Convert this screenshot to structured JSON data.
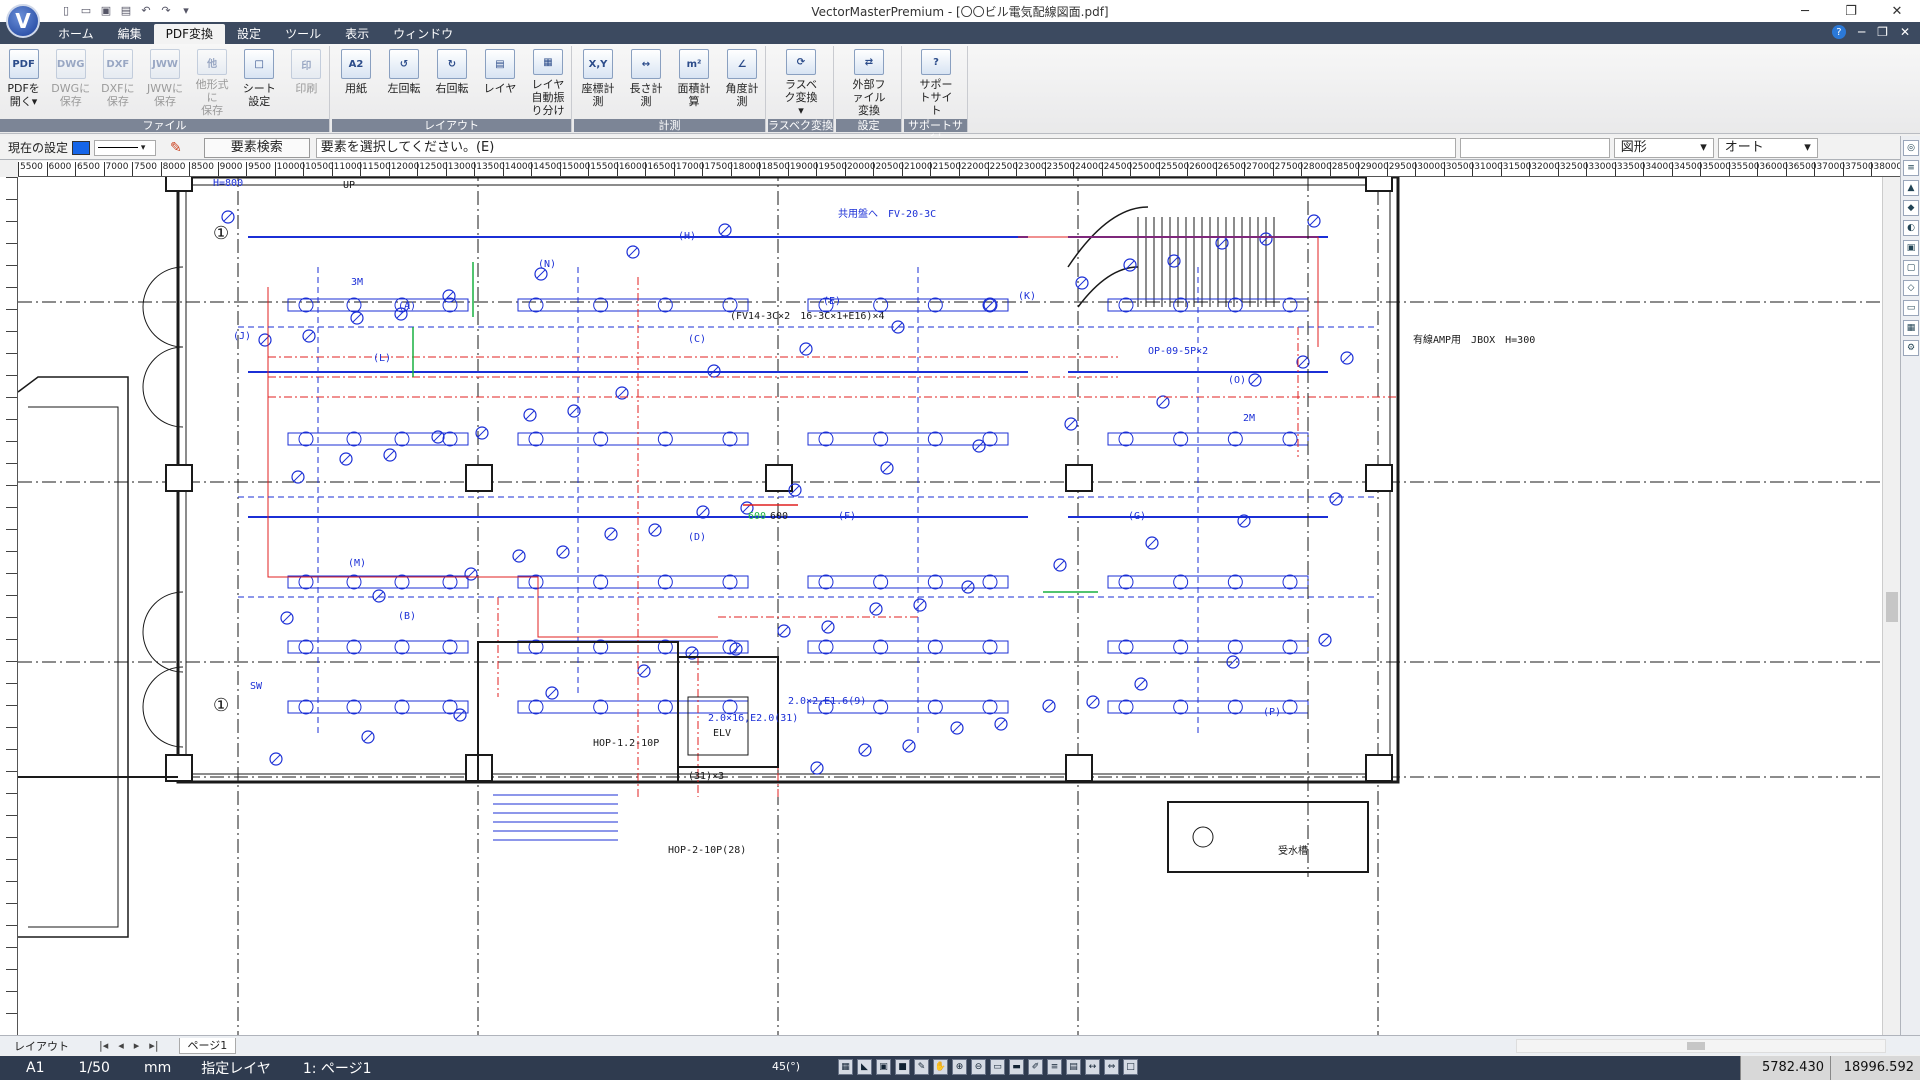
{
  "window": {
    "title": "VectorMasterPremium - [〇〇ビル電気配線図面.pdf]",
    "controls": [
      "─",
      "❐",
      "✕"
    ]
  },
  "app_logo": "V",
  "menu": {
    "tabs": [
      "ホーム",
      "編集",
      "PDF変換",
      "設定",
      "ツール",
      "表示",
      "ウィンドウ"
    ],
    "active": "PDF変換",
    "right": [
      "?",
      "─",
      "❐",
      "✕"
    ]
  },
  "ribbon": {
    "groups": [
      {
        "label": "ファイル",
        "buttons": [
          {
            "icon": "PDF",
            "label": "PDFを\n開く▾",
            "disabled": false
          },
          {
            "icon": "DWG",
            "label": "DWGに\n保存",
            "disabled": true
          },
          {
            "icon": "DXF",
            "label": "DXFに\n保存",
            "disabled": true
          },
          {
            "icon": "JWW",
            "label": "JWWに\n保存",
            "disabled": true
          },
          {
            "icon": "他",
            "label": "他形式に\n保存",
            "disabled": true
          },
          {
            "icon": "□",
            "label": "シート設定",
            "disabled": false
          },
          {
            "icon": "印",
            "label": "印刷",
            "disabled": true
          }
        ]
      },
      {
        "label": "レイアウト",
        "buttons": [
          {
            "icon": "A2",
            "label": "用紙",
            "disabled": false
          },
          {
            "icon": "↺",
            "label": "左回転",
            "disabled": false
          },
          {
            "icon": "↻",
            "label": "右回転",
            "disabled": false
          },
          {
            "icon": "▤",
            "label": "レイヤ",
            "disabled": false
          },
          {
            "icon": "▦",
            "label": "レイヤ\n自動振り分け",
            "disabled": false
          }
        ]
      },
      {
        "label": "計測",
        "buttons": [
          {
            "icon": "X,Y",
            "label": "座標計測",
            "disabled": false
          },
          {
            "icon": "↔",
            "label": "長さ計測",
            "disabled": false
          },
          {
            "icon": "m²",
            "label": "面積計算",
            "disabled": false
          },
          {
            "icon": "∠",
            "label": "角度計測",
            "disabled": false
          }
        ]
      },
      {
        "label": "ラスベク変換",
        "buttons": [
          {
            "icon": "⟳",
            "label": "ラスベク変換\n▾",
            "disabled": false
          }
        ]
      },
      {
        "label": "設定",
        "buttons": [
          {
            "icon": "⇄",
            "label": "外部ファイル\n変換",
            "disabled": false
          }
        ]
      },
      {
        "label": "サポートサイト",
        "buttons": [
          {
            "icon": "?",
            "label": "サポートサイト",
            "disabled": false
          }
        ]
      }
    ]
  },
  "command_bar": {
    "current_setting": "現在の設定",
    "element_search": "要素検索",
    "prompt": "要素を選択してください。(E)",
    "shape_select": "図形",
    "auto_select": "オート"
  },
  "hruler_labels": [
    "5500",
    "6000",
    "6500",
    "7000",
    "7500",
    "8000",
    "8500",
    "9000",
    "9500",
    "10000",
    "10500",
    "11000",
    "11500",
    "12000",
    "12500",
    "13000",
    "13500",
    "14000",
    "14500",
    "15000",
    "15500",
    "16000",
    "16500",
    "17000",
    "17500",
    "18000",
    "18500",
    "19000",
    "19500",
    "20000",
    "20500",
    "21000",
    "21500",
    "22000",
    "22500",
    "23000",
    "23500",
    "24000",
    "24500",
    "25000",
    "25500",
    "26000",
    "26500",
    "27000",
    "27500",
    "28000",
    "28500",
    "29000",
    "29500",
    "30000",
    "30500",
    "31000",
    "31500",
    "32000",
    "32500",
    "33000",
    "33500",
    "34000",
    "34500",
    "35000",
    "35500",
    "36000",
    "36500",
    "37000",
    "37500",
    "38000"
  ],
  "drawing": {
    "colors": {
      "line": "#1a1a1a",
      "blue": "#1b2fd6",
      "red": "#e02020",
      "green": "#18b040"
    },
    "labels": [
      {
        "text": "H=800",
        "color": "blue"
      },
      {
        "text": "UP",
        "color": "line"
      },
      {
        "text": "①",
        "color": "line"
      },
      {
        "text": "①",
        "color": "line"
      },
      {
        "text": "共用盤へ　FV-20-3C",
        "color": "blue"
      },
      {
        "text": "(FV14-3C×2　16-3C×1+E16)×4",
        "color": "line"
      },
      {
        "text": "OP-09-5P×2",
        "color": "blue"
      },
      {
        "text": "有線AMP用　JBOX　H=300",
        "color": "line"
      },
      {
        "text": "ELV",
        "color": "line"
      },
      {
        "text": "2.0×16,E2.0(31)",
        "color": "blue"
      },
      {
        "text": "2.0×2,E1.6(9)",
        "color": "blue"
      },
      {
        "text": "(31)×3",
        "color": "line"
      },
      {
        "text": "HOP-2-10P(28)",
        "color": "line"
      },
      {
        "text": "HOP-1.2-10P",
        "color": "line"
      },
      {
        "text": "600",
        "color": "green"
      },
      {
        "text": "600",
        "color": "line"
      },
      {
        "text": "(A)",
        "color": "blue"
      },
      {
        "text": "(B)",
        "color": "blue"
      },
      {
        "text": "(C)",
        "color": "blue"
      },
      {
        "text": "(D)",
        "color": "blue"
      },
      {
        "text": "(E)",
        "color": "blue"
      },
      {
        "text": "(F)",
        "color": "blue"
      },
      {
        "text": "(G)",
        "color": "blue"
      },
      {
        "text": "(H)",
        "color": "blue"
      },
      {
        "text": "(J)",
        "color": "blue"
      },
      {
        "text": "(K)",
        "color": "blue"
      },
      {
        "text": "(L)",
        "color": "blue"
      },
      {
        "text": "(M)",
        "color": "blue"
      },
      {
        "text": "(N)",
        "color": "blue"
      },
      {
        "text": "(O)",
        "color": "blue"
      },
      {
        "text": "(P)",
        "color": "blue"
      },
      {
        "text": "3M",
        "color": "blue"
      },
      {
        "text": "2M",
        "color": "blue"
      },
      {
        "text": "SW",
        "color": "blue"
      },
      {
        "text": "受水槽",
        "color": "line"
      }
    ]
  },
  "sheet_bar": {
    "layout_sheet": "レイアウト",
    "nav": [
      "|◂",
      "◂",
      "▸",
      "▸|"
    ],
    "page_tab": "ページ1"
  },
  "status": {
    "paper": "A1",
    "scale": "1/50",
    "unit": "mm",
    "layer_mode": "指定レイヤ",
    "layer": "1: ページ1",
    "angle": "45(°)",
    "x": "5782.430",
    "y": "18996.592"
  }
}
